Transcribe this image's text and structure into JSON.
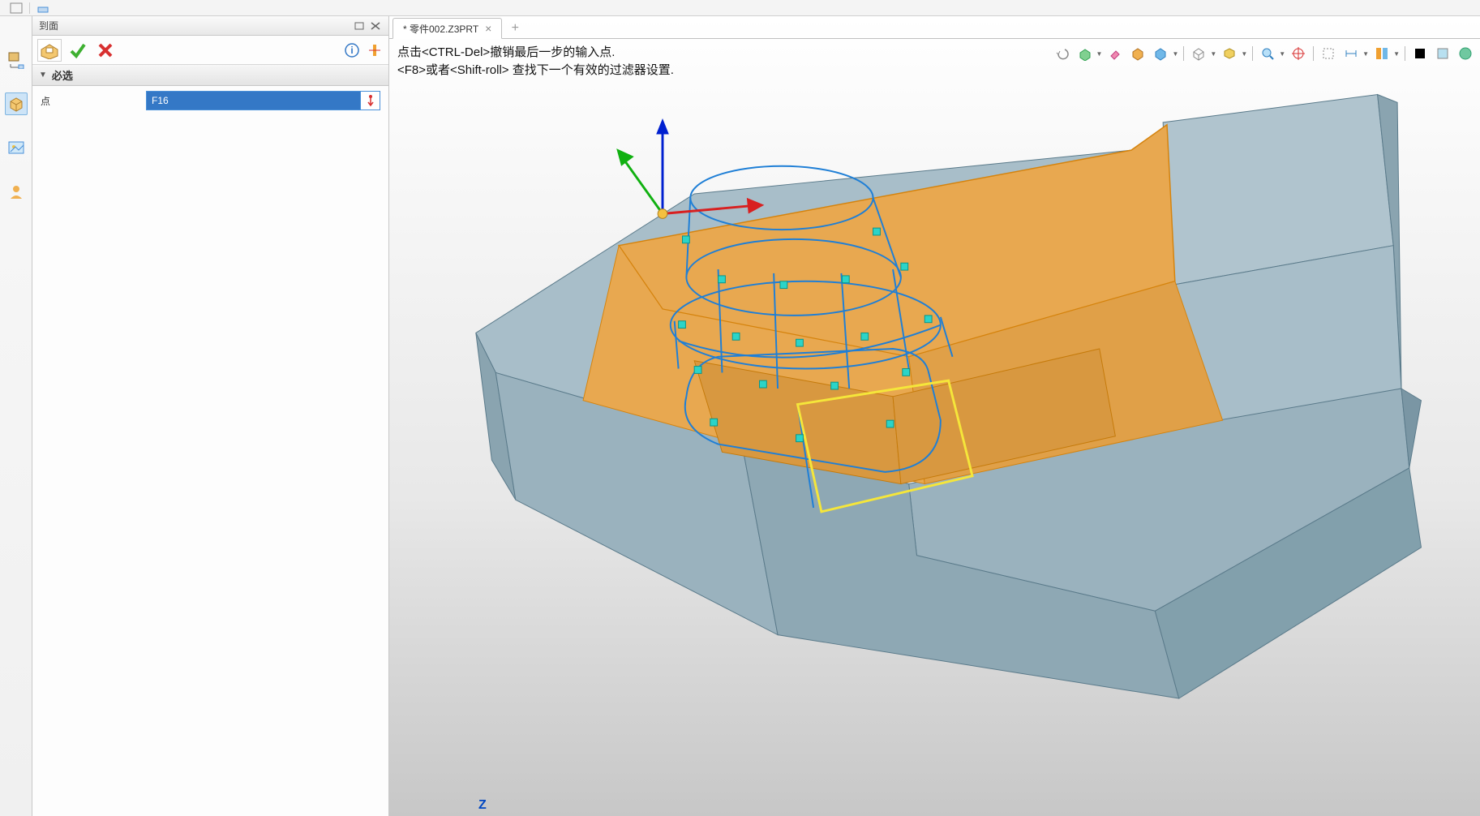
{
  "panel": {
    "title": "到面",
    "section_header": "必选",
    "point_label": "点",
    "point_value": "F16"
  },
  "tab": {
    "label": "* 零件002.Z3PRT"
  },
  "hint": {
    "line1": "点击<CTRL-Del>撤销最后一步的输入点.",
    "line2": "<F8>或者<Shift-roll> 查找下一个有效的过滤器设置."
  },
  "axis": {
    "z_label": "Z"
  },
  "colors": {
    "accent_blue": "#3478c6",
    "model_body": "#a8bec9",
    "model_cut": "#e8a850",
    "wire_blue": "#1f7fd6",
    "highlight_yellow": "#f5e63a",
    "node_cyan": "#2bd4c8"
  }
}
